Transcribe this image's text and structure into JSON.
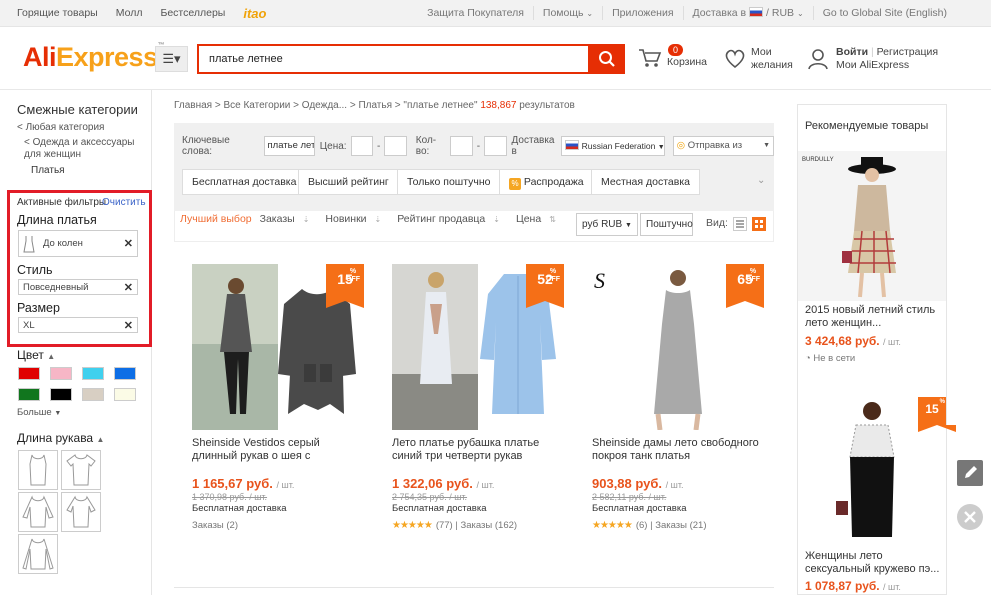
{
  "topbar": {
    "left": [
      "Горящие товары",
      "Молл",
      "Бестселлеры",
      "itao"
    ],
    "right": [
      "Защита Покупателя",
      "Помощь",
      "Приложения",
      "Доставка в",
      "RUB",
      "Go to Global Site (English)"
    ]
  },
  "header": {
    "logo_part1": "Ali",
    "logo_part2": "Express",
    "search_value": "платье летнее",
    "cart_count": "0",
    "cart_label": "Корзина",
    "wish_line1": "Мои",
    "wish_line2": "желания",
    "login": "Войти",
    "register": "Регистрация",
    "my_ali": "Мои AliExpress"
  },
  "sidebar": {
    "title": "Смежные категории",
    "any_category": "< Любая категория",
    "cat_line1": "< Одежда и аксессуары",
    "cat_line2": "для женщин",
    "current": "Платья",
    "active_filters": "Активные фильтры",
    "clear": "Очистить",
    "dress_length_title": "Длина платья",
    "dress_length_value": "До колен",
    "style_title": "Стиль",
    "style_value": "Повседневный",
    "size_title": "Размер",
    "size_value": "XL",
    "color_title": "Цвет",
    "colors": [
      "#e00000",
      "#f7b6c6",
      "#3fd0ee",
      "#0d6ee6",
      "#11761e",
      "#000000",
      "#d8cfc3",
      "#fbfbe6"
    ],
    "more": "Больше",
    "sleeve_title": "Длина рукава"
  },
  "main": {
    "breadcrumb": "Главная > Все Категории > Одежда... > Платья > \"платье летнее\"",
    "result_count": "138,867",
    "result_label": "результатов",
    "keywords_label": "Ключевые слова:",
    "keywords_value": "платье лет",
    "price_label": "Цена:",
    "qty_label": "Кол-во:",
    "ship_to_label": "Доставка в",
    "ship_to_value": "Russian Federation",
    "ship_from": "Отправка из",
    "filter_buttons": [
      "Бесплатная доставка",
      "Высший рейтинг",
      "Только поштучно",
      "Распродажа",
      "Местная доставка"
    ],
    "sort": [
      "Лучший выбор",
      "Заказы",
      "Новинки",
      "Рейтинг продавца",
      "Цена"
    ],
    "currency": "руб RUB",
    "per_piece": "Поштучно",
    "view_label": "Вид:"
  },
  "products": [
    {
      "discount": "15",
      "title": "Sheinside Vestidos серый длинный рукав о шея с",
      "price": "1 165,67 руб.",
      "unit": "/ шт.",
      "old_price": "1 370,98 руб. / шт.",
      "shipping": "Бесплатная доставка",
      "rating_count": "",
      "orders": "Заказы (2)"
    },
    {
      "discount": "52",
      "title": "Лето платье рубашка платье синий три четверти рукав",
      "price": "1 322,06 руб.",
      "unit": "/ шт.",
      "old_price": "2 754,35 руб. / шт.",
      "shipping": "Бесплатная доставка",
      "rating_count": "(77)",
      "orders": "Заказы (162)"
    },
    {
      "discount": "65",
      "title": "Sheinside дамы лето свободного покроя танк платья",
      "price": "903,88 руб.",
      "unit": "/ шт.",
      "old_price": "2 582,11 руб. / шт.",
      "shipping": "Бесплатная доставка",
      "rating_count": "(6)",
      "orders": "Заказы (21)"
    }
  ],
  "recommended": {
    "title": "Рекомендуемые товары",
    "item1_title": "2015 новый летний стиль лето женщин...",
    "item1_price": "3 424,68 руб.",
    "item1_unit": "/ шт.",
    "item1_stock": "Не в сети",
    "item2_discount": "15",
    "item2_title": "Женщины лето сексуальный кружево пэ...",
    "item2_price": "1 078,87 руб.",
    "item2_unit": "/ шт."
  },
  "off_label": "OFF",
  "percent": "%"
}
